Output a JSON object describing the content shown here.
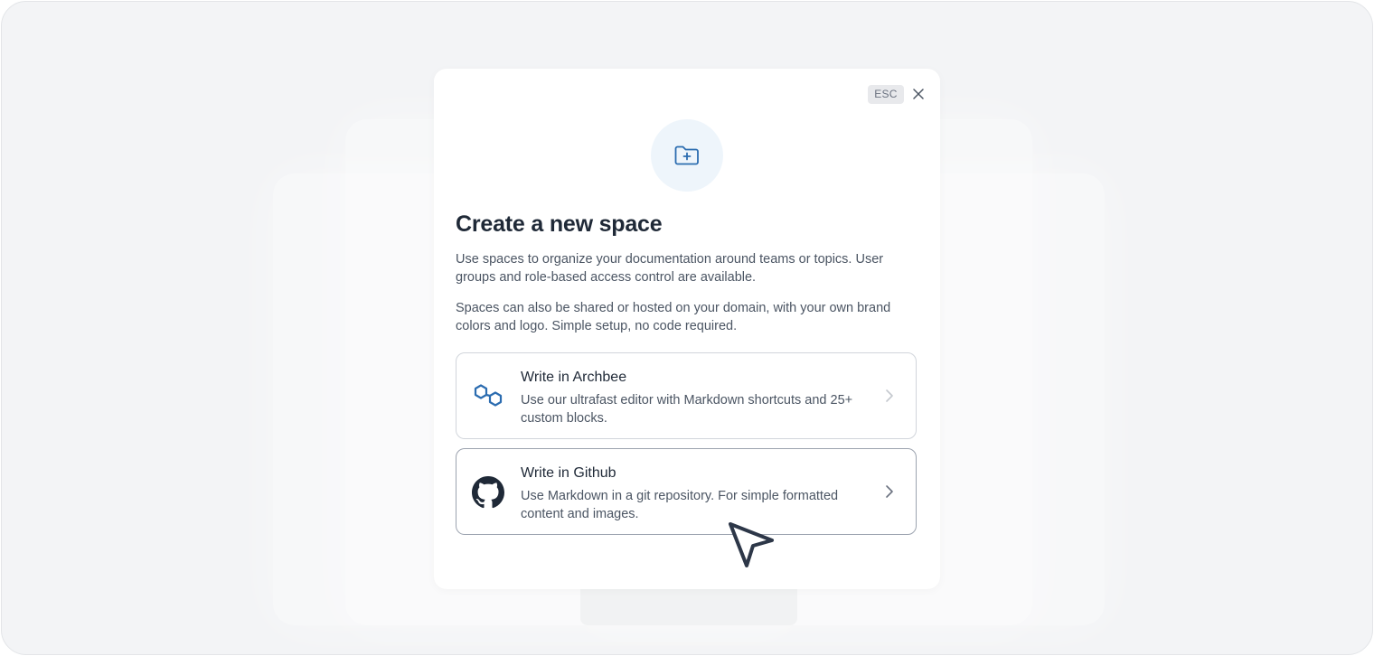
{
  "modal": {
    "esc_label": "ESC",
    "title": "Create a new space",
    "paragraph1": "Use spaces to organize your documentation around teams or topics. User groups and role-based access control are available.",
    "paragraph2": "Spaces can also be shared or hosted on your domain, with your own brand colors and logo. Simple setup, no code required.",
    "hero_icon": "folder-plus-icon",
    "options": [
      {
        "title": "Write in Archbee",
        "description": "Use our ultrafast editor with Markdown shortcuts and 25+ custom blocks.",
        "icon": "archbee-logo-icon"
      },
      {
        "title": "Write in Github",
        "description": "Use Markdown in a git repository. For simple formatted content and images.",
        "icon": "github-icon"
      }
    ]
  },
  "colors": {
    "accent": "#2b6cb0",
    "background": "#f3f4f6",
    "text_primary": "#1f2937",
    "text_secondary": "#4b5563"
  }
}
